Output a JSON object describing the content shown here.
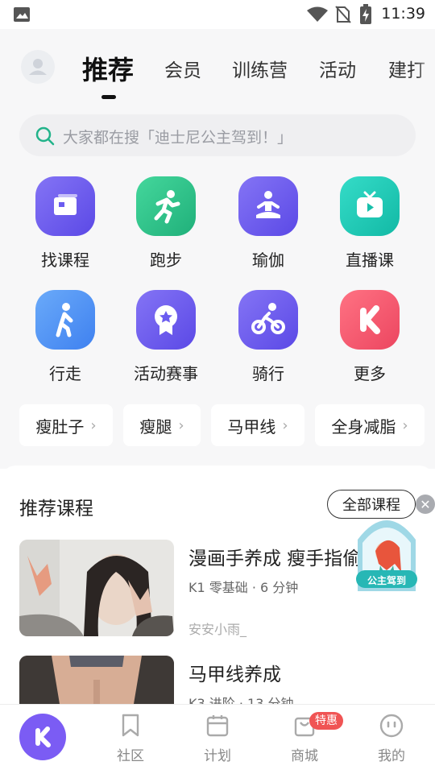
{
  "status_bar": {
    "time": "11:39"
  },
  "header": {
    "tabs": [
      {
        "label": "推荐",
        "active": true
      },
      {
        "label": "会员"
      },
      {
        "label": "训练营"
      },
      {
        "label": "活动"
      },
      {
        "label": "建打"
      }
    ]
  },
  "search": {
    "placeholder": "大家都在搜「迪士尼公主驾到！」"
  },
  "categories": [
    {
      "label": "找课程",
      "icon": "course-card-icon",
      "color": "#6b5cf0"
    },
    {
      "label": "跑步",
      "icon": "running-icon",
      "color": "#2ec48a"
    },
    {
      "label": "瑜伽",
      "icon": "yoga-icon",
      "color": "#6b5cf0"
    },
    {
      "label": "直播课",
      "icon": "tv-play-icon",
      "color": "#1ec9b6"
    },
    {
      "label": "行走",
      "icon": "walking-icon",
      "color": "#4b8ff6"
    },
    {
      "label": "活动赛事",
      "icon": "medal-star-icon",
      "color": "#6b5cf0"
    },
    {
      "label": "骑行",
      "icon": "cycling-icon",
      "color": "#6b5cf0"
    },
    {
      "label": "更多",
      "icon": "keep-logo-icon",
      "color": "#f0556b"
    }
  ],
  "chips": [
    {
      "label": "瘦肚子"
    },
    {
      "label": "瘦腿"
    },
    {
      "label": "马甲线"
    },
    {
      "label": "全身减脂"
    }
  ],
  "recommended": {
    "title": "推荐课程",
    "all_button": "全部课程",
    "courses": [
      {
        "title": "漫画手养成 瘦手指偷",
        "meta": "K1 零基础 · 6 分钟",
        "author": "安安小雨_"
      },
      {
        "title": "马甲线养成",
        "meta": "K3 进阶 · 13 分钟"
      }
    ],
    "promo_label": "公主驾到"
  },
  "bottom_nav": {
    "items": [
      {
        "label": "社区",
        "icon": "bookmark-icon"
      },
      {
        "label": "计划",
        "icon": "calendar-icon"
      },
      {
        "label": "商城",
        "icon": "shop-bag-icon"
      },
      {
        "label": "我的",
        "icon": "profile-face-icon"
      }
    ],
    "shop_badge": "特惠"
  },
  "colors": {
    "accent": "#7b5cf4",
    "badge": "#f05454"
  }
}
